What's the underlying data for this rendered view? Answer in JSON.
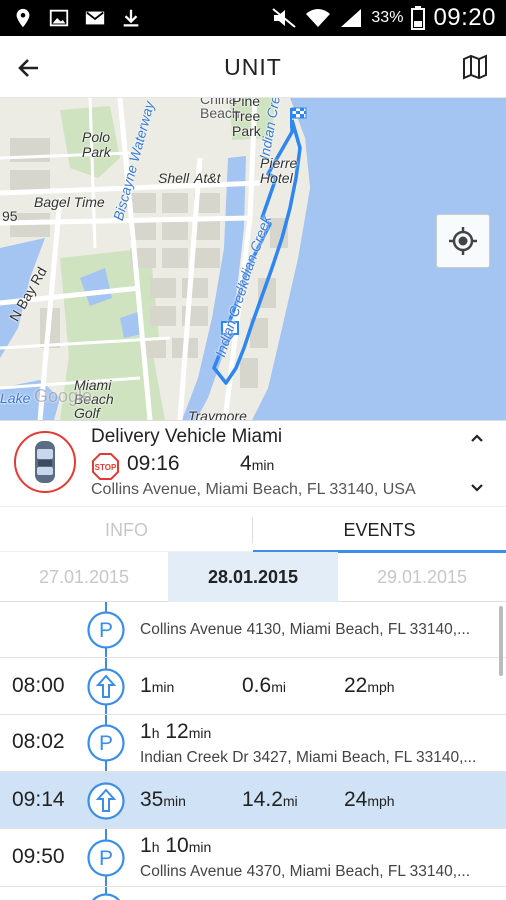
{
  "status_bar": {
    "battery": "33%",
    "time": "09:20"
  },
  "app_bar": {
    "title": "UNIT"
  },
  "map": {
    "labels": {
      "china_beach": "China\nBeach",
      "pine_tree_park": "Pine\nTree\nPark",
      "indian_creek_top": "Indian Creek",
      "polo_park": "Polo\nPark",
      "biscayne_waterway": "Biscayne Waterway",
      "shell": "Shell",
      "atandt": "At&t",
      "pierre_hotel": "Pierre\nHotel",
      "bagel_time": "Bagel Time",
      "road_95": "95",
      "indian_creek_mid": "Indian Creek",
      "n_bay_rd": "N Bay Rd",
      "indian_creek_lower": "Indian Creek",
      "miami_beach_golf": "Miami\nBeach\nGolf",
      "lake": "Lake",
      "google": "Google",
      "traymore": "Traymore"
    }
  },
  "unit": {
    "name": "Delivery Vehicle Miami",
    "stop_icon_text": "STOP",
    "state_time": "09:16",
    "duration_value": "4",
    "duration_unit": "min",
    "address": "Collins Avenue, Miami Beach, FL 33140, USA"
  },
  "tabs": {
    "info": "INFO",
    "events": "EVENTS",
    "active": "events"
  },
  "dates": {
    "prev": "27.01.2015",
    "current": "28.01.2015",
    "next": "29.01.2015"
  },
  "events": [
    {
      "type": "parking",
      "time": "",
      "address": "Collins Avenue 4130, Miami Beach, FL 33140,..."
    },
    {
      "type": "trip",
      "time": "08:00",
      "duration_value": "1",
      "duration_unit": "min",
      "distance_value": "0.6",
      "distance_unit": "mi",
      "speed_value": "22",
      "speed_unit": "mph"
    },
    {
      "type": "parking",
      "time": "08:02",
      "stay_h": "1",
      "stay_h_unit": "h",
      "stay_m": "12",
      "stay_m_unit": "min",
      "address": "Indian Creek Dr 3427, Miami Beach, FL 33140,..."
    },
    {
      "type": "trip",
      "time": "09:14",
      "highlighted": true,
      "duration_value": "35",
      "duration_unit": "min",
      "distance_value": "14.2",
      "distance_unit": "mi",
      "speed_value": "24",
      "speed_unit": "mph"
    },
    {
      "type": "parking",
      "time": "09:50",
      "stay_h": "1",
      "stay_h_unit": "h",
      "stay_m": "10",
      "stay_m_unit": "min",
      "address": "Collins Avenue 4370, Miami Beach, FL 33140,..."
    }
  ],
  "colors": {
    "accent": "#3a8ee6",
    "stop_red": "#e53935",
    "highlight": "#cfe2f6",
    "water": "#a4c4f2"
  }
}
